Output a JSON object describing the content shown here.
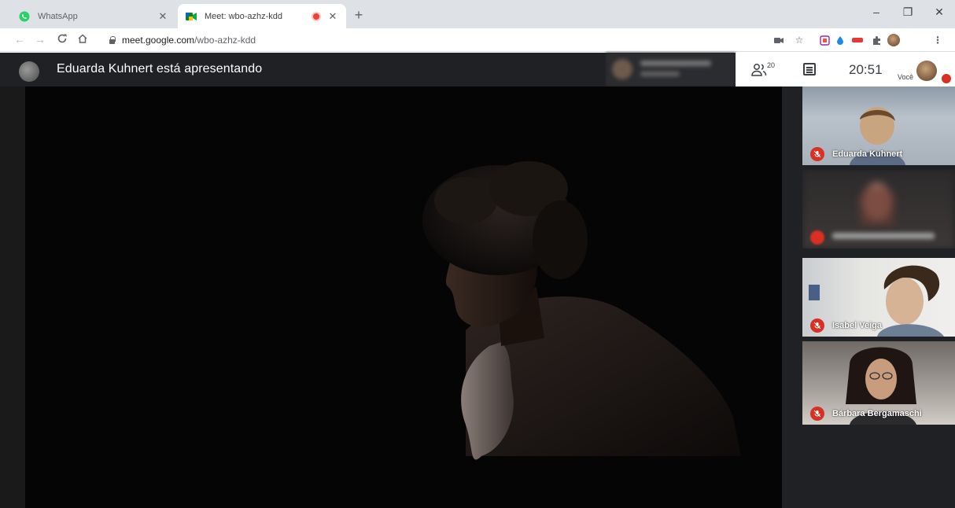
{
  "browser": {
    "tabs": [
      {
        "title": "WhatsApp",
        "active": false,
        "icon": "whatsapp-icon"
      },
      {
        "title": "Meet: wbo-azhz-kdd",
        "active": true,
        "icon": "google-meet-icon",
        "recording": true
      }
    ],
    "new_tab_label": "+",
    "window_controls": {
      "minimize": "–",
      "restore": "❐",
      "close": "✕"
    },
    "address": {
      "host": "meet.google.com",
      "path": "/wbo-azhz-kdd"
    }
  },
  "meet": {
    "presenting_text": "Eduarda Kuhnert está apresentando",
    "participant_count": "20",
    "clock": "20:51",
    "self_label": "Você",
    "participants": [
      {
        "name": "Eduarda Kuhnert",
        "muted": true,
        "blurred": false
      },
      {
        "name": "",
        "muted": true,
        "blurred": true
      },
      {
        "name": "Isabel Veiga",
        "muted": true,
        "blurred": false
      },
      {
        "name": "Bárbara Bergamaschi",
        "muted": true,
        "blurred": false
      }
    ]
  },
  "colors": {
    "tabstrip": "#dee1e6",
    "meet_background": "#202124",
    "mute_red": "#d93025",
    "whatsapp_green": "#25d366"
  }
}
